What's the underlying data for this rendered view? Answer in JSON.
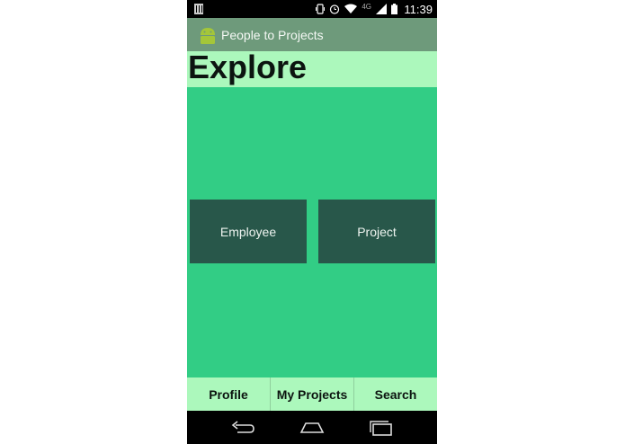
{
  "status_bar": {
    "time": "11:39",
    "network": "4G",
    "icons": [
      "notification-icon",
      "vibrate-icon",
      "alarm-icon",
      "wifi-icon",
      "signal-icon",
      "battery-icon"
    ]
  },
  "action_bar": {
    "app_icon": "android-icon",
    "title": "People to Projects"
  },
  "header": {
    "title": "Explore"
  },
  "tiles": [
    {
      "label": "Employee"
    },
    {
      "label": "Project"
    }
  ],
  "tabs": [
    {
      "label": "Profile"
    },
    {
      "label": "My Projects"
    },
    {
      "label": "Search"
    }
  ],
  "nav_bar": {
    "icons": [
      "back-icon",
      "home-icon",
      "recents-icon"
    ]
  },
  "colors": {
    "status_bar": "#000000",
    "action_bar": "#6e9a7b",
    "header": "#acf8bc",
    "content": "#32cd85",
    "tile": "#28574a",
    "tab_bar": "#acf8bc",
    "nav_bar": "#000000"
  }
}
